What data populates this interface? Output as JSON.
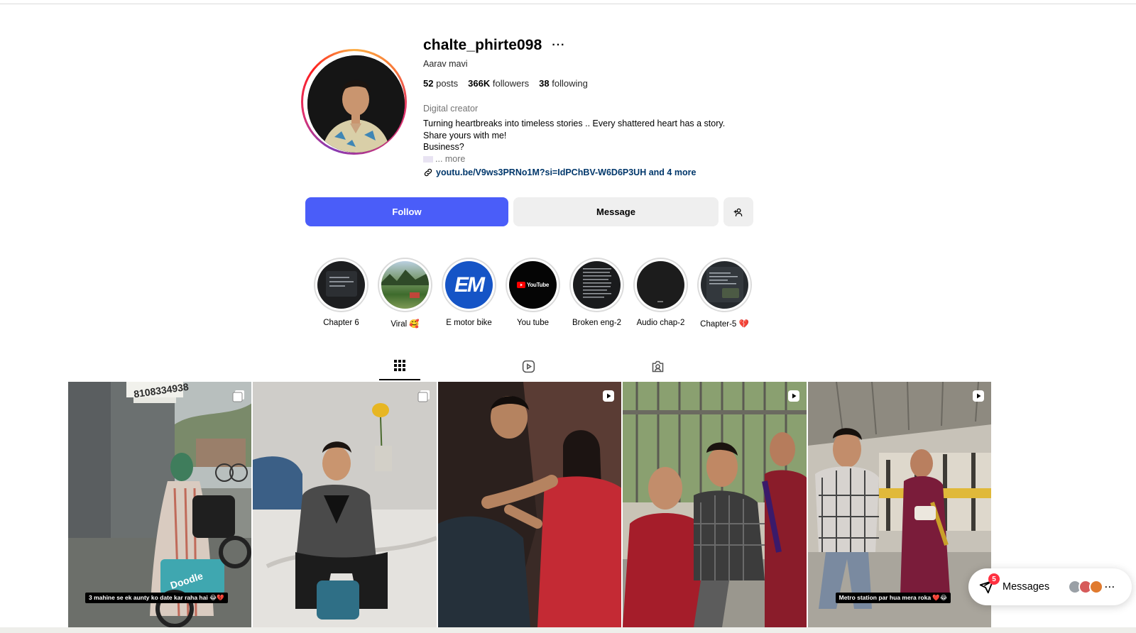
{
  "profile": {
    "username": "chalte_phirte098",
    "more_label": "···",
    "full_name": "Aarav mavi",
    "stats": {
      "posts_count": "52",
      "posts_label": "posts",
      "followers_count": "366K",
      "followers_label": "followers",
      "following_count": "38",
      "following_label": "following"
    },
    "category": "Digital creator",
    "bio_lines": [
      "Turning heartbreaks into timeless stories .. Every shattered heart has a story.",
      "Share yours with me!",
      "Business?"
    ],
    "bio_more": "... more",
    "link_text": "youtu.be/V9ws3PRNo1M?si=IdPChBV-W6D6P3UH and 4 more"
  },
  "actions": {
    "follow_label": "Follow",
    "message_label": "Message"
  },
  "highlights": [
    {
      "label": "Chapter 6"
    },
    {
      "label": "Viral 🥰"
    },
    {
      "label": "E motor bike",
      "logo_text": "EM"
    },
    {
      "label": "You tube",
      "logo_text": "YouTube"
    },
    {
      "label": "Broken eng-2"
    },
    {
      "label": "Audio chap-2"
    },
    {
      "label": "Chapter-5 💔"
    }
  ],
  "tabs": [
    {
      "icon": "grid-icon",
      "active": true
    },
    {
      "icon": "reels-icon",
      "active": false
    },
    {
      "icon": "tagged-icon",
      "active": false
    }
  ],
  "posts": [
    {
      "badge": "carousel-icon",
      "caption": "3 mahine se ek aunty ko date kar raha hai 😂💔",
      "overlay_text": "8108334938",
      "overlay_text_2": "Doodle"
    },
    {
      "badge": "carousel-icon",
      "caption": ""
    },
    {
      "badge": "reel-icon",
      "caption": ""
    },
    {
      "badge": "reel-icon",
      "caption": ""
    },
    {
      "badge": "reel-icon",
      "caption": "Metro station par hua mera roka ❤️😂"
    }
  ],
  "messages": {
    "label": "Messages",
    "unread_count": "5",
    "more": "···"
  },
  "colors": {
    "follow_button": "#4a5df9",
    "secondary_button": "#efefef",
    "link": "#00376b",
    "badge": "#ff3040"
  }
}
